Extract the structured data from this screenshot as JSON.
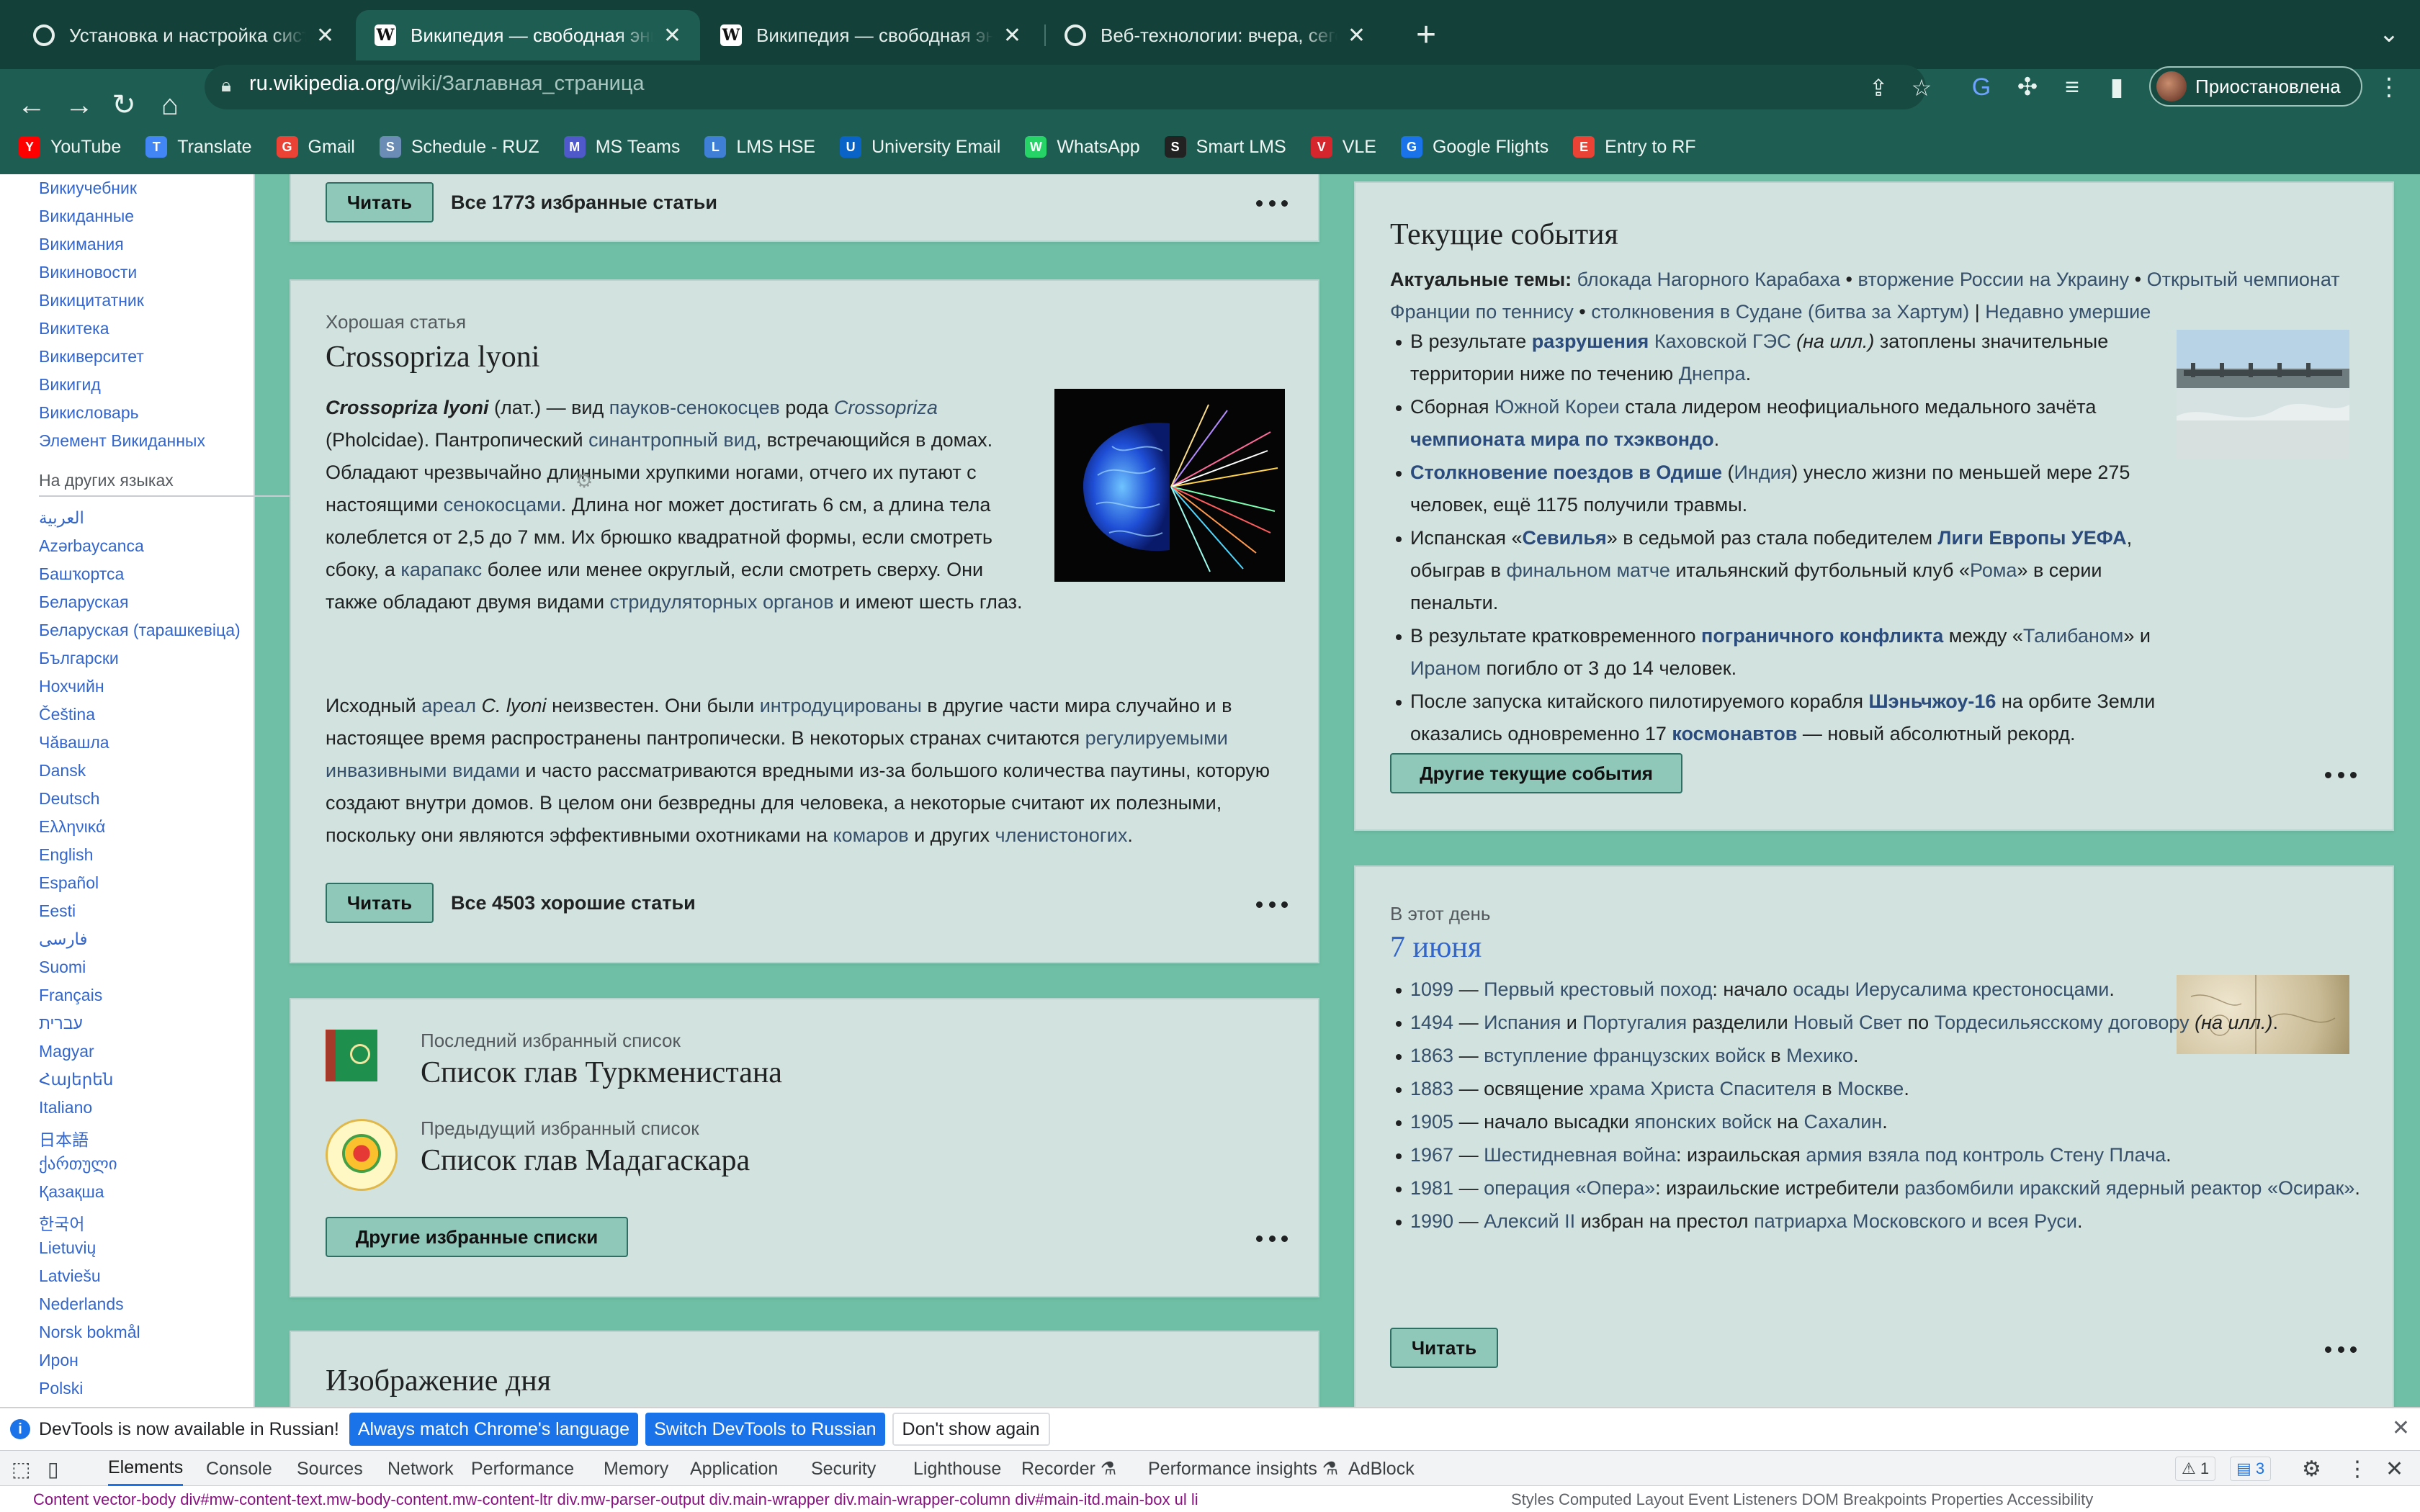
{
  "browser": {
    "tabs": [
      {
        "title": "Установка и настройка систе",
        "icon": "chrome-settings-icon"
      },
      {
        "title": "Википедия — свободная энци",
        "icon": "wikipedia-icon",
        "active": true
      },
      {
        "title": "Википедия — свободная энци",
        "icon": "wikipedia-icon"
      },
      {
        "title": "Веб-технологии: вчера, сегод",
        "icon": "chrome-settings-icon"
      }
    ],
    "url_domain": "ru.wikipedia.org",
    "url_path": "/wiki/Заглавная_страница",
    "profile_status": "Приостановлена",
    "bookmarks": [
      {
        "label": "YouTube",
        "icon": "youtube-icon",
        "color": "#ff0000"
      },
      {
        "label": "Translate",
        "icon": "translate-icon",
        "color": "#4285f4"
      },
      {
        "label": "Gmail",
        "icon": "gmail-icon",
        "color": "#ea4335"
      },
      {
        "label": "Schedule - RUZ",
        "icon": "schedule-icon",
        "color": "#6b8db5"
      },
      {
        "label": "MS Teams",
        "icon": "teams-icon",
        "color": "#5059c9"
      },
      {
        "label": "LMS HSE",
        "icon": "lms-icon",
        "color": "#3f7fd6"
      },
      {
        "label": "University Email",
        "icon": "outlook-icon",
        "color": "#0a64c8"
      },
      {
        "label": "WhatsApp",
        "icon": "whatsapp-icon",
        "color": "#25d366"
      },
      {
        "label": "Smart LMS",
        "icon": "smartlms-icon",
        "color": "#222222"
      },
      {
        "label": "VLE",
        "icon": "vle-icon",
        "color": "#d4262c"
      },
      {
        "label": "Google Flights",
        "icon": "flights-icon",
        "color": "#1a73e8"
      },
      {
        "label": "Entry to RF",
        "icon": "google-icon",
        "color": "#ea4335"
      }
    ]
  },
  "sidebar": {
    "projects": [
      "Викиучебник",
      "Викиданные",
      "Викимания",
      "Викиновости",
      "Викицитатник",
      "Викитека",
      "Викиверситет",
      "Викигид",
      "Викисловарь",
      "Элемент Викиданных"
    ],
    "languages_heading": "На других языках",
    "languages": [
      "العربية",
      "Azərbaycanca",
      "Башҡортса",
      "Беларуская",
      "Беларуская (тарашкевіца)",
      "Български",
      "Нохчийн",
      "Čeština",
      "Чӑвашла",
      "Dansk",
      "Deutsch",
      "Ελληνικά",
      "English",
      "Español",
      "Eesti",
      "فارسی",
      "Suomi",
      "Français",
      "עברית",
      "Magyar",
      "Հայերեն",
      "Italiano",
      "日本語",
      "ქართული",
      "Қазақша",
      "한국어",
      "Lietuvių",
      "Latviešu",
      "Nederlands",
      "Norsk bokmål",
      "Ирон",
      "Polski"
    ]
  },
  "featured": {
    "read_label": "Читать",
    "all_label": "Все 1773 избранные статьи"
  },
  "good_article": {
    "kicker": "Хорошая статья",
    "title": "Crossopriza lyoni",
    "p1": {
      "t1": "Crossopriza lyoni",
      "t2": " (лат.) — вид ",
      "t3": "пауков-сенокосцев",
      "t4": " рода ",
      "t5": "Crossopriza",
      "t6": " (Pholcidae). Пантропический ",
      "t7": "синантропный вид",
      "t8": ", встречающийся в домах. Обладают чрезвычайно длинными хрупкими ногами, отчего их путают с настоящими ",
      "t9": "сенокосцами",
      "t10": ". Длина ног может достигать 6 см, а длина тела колеблется от 2,5 до 7 мм. Их брюшко квадратной формы, если смотреть сбоку, а ",
      "t11": "карапакс",
      "t12": " более или менее округлый, если смотреть сверху. Они также обладают двумя видами ",
      "t13": "стридуляторных органов",
      "t14": " и имеют шесть глаз."
    },
    "p2": {
      "t1": "Исходный ",
      "t2": "ареал",
      "t3": " C. lyoni",
      "t4": " неизвестен. Они были ",
      "t5": "интродуцированы",
      "t6": " в другие части мира случайно и в настоящее время распространены пантропически. В некоторых странах считаются ",
      "t7": "регулируемыми инвазивными видами",
      "t8": " и часто рассматриваются вредными из-за большого количества паутины, которую создают внутри домов. В целом они безвредны для человека, а некоторые считают их полезными, поскольку они являются эффективными охотниками на ",
      "t9": "комаров",
      "t10": " и других ",
      "t11": "членистоногих",
      "t12": "."
    },
    "read_label": "Читать",
    "all_label": "Все 4503 хорошие статьи"
  },
  "lists": {
    "latest_kicker": "Последний избранный список",
    "latest_title": "Список глав Туркменистана",
    "prev_kicker": "Предыдущий избранный список",
    "prev_title": "Список глав Мадагаскара",
    "more_label": "Другие избранные списки"
  },
  "image_of_day": {
    "title": "Изображение дня"
  },
  "current_events": {
    "title": "Текущие события",
    "topics_label": "Актуальные темы:",
    "topics": [
      {
        "t": " блокада Нагорного Карабаха",
        "link": true
      },
      {
        "t": " • ",
        "link": false
      },
      {
        "t": "вторжение России на Украину",
        "link": true
      },
      {
        "t": " • ",
        "link": false
      },
      {
        "t": "Открытый чемпионат Франции по теннису",
        "link": true
      },
      {
        "t": " • ",
        "link": false
      },
      {
        "t": "столкновения в Судане (битва за Хартум)",
        "link": true
      },
      {
        "t": " | ",
        "link": false
      },
      {
        "t": "Недавно умершие",
        "link": true
      }
    ],
    "items": [
      [
        {
          "t": "В результате "
        },
        {
          "t": "разрушения",
          "b": true
        },
        {
          "t": " "
        },
        {
          "t": "Каховской ГЭС",
          "l": true
        },
        {
          "t": " (на илл.)",
          "i": true
        },
        {
          "t": " затоплены значительные территории ниже по течению "
        },
        {
          "t": "Днепра",
          "l": true
        },
        {
          "t": "."
        }
      ],
      [
        {
          "t": "Сборная "
        },
        {
          "t": "Южной Кореи",
          "l": true
        },
        {
          "t": " стала лидером неофициального медального зачёта "
        },
        {
          "t": "чемпионата мира по тхэквондо",
          "b": true
        },
        {
          "t": "."
        }
      ],
      [
        {
          "t": "Столкновение поездов в Одише",
          "b": true
        },
        {
          "t": " ("
        },
        {
          "t": "Индия",
          "l": true
        },
        {
          "t": ") унесло жизни по меньшей мере 275 человек, ещё 1175 получили травмы."
        }
      ],
      [
        {
          "t": "Испанская «"
        },
        {
          "t": "Севилья",
          "b": true
        },
        {
          "t": "» в седьмой раз стала победителем "
        },
        {
          "t": "Лиги Европы УЕФА",
          "b": true
        },
        {
          "t": ", обыграв в "
        },
        {
          "t": "финальном матче",
          "l": true
        },
        {
          "t": " итальянский футбольный клуб «"
        },
        {
          "t": "Рома",
          "l": true
        },
        {
          "t": "» в серии пенальти."
        }
      ],
      [
        {
          "t": "В результате кратковременного "
        },
        {
          "t": "пограничного конфликта",
          "b": true
        },
        {
          "t": " между «"
        },
        {
          "t": "Талибаном",
          "l": true
        },
        {
          "t": "» и "
        },
        {
          "t": "Ираном",
          "l": true
        },
        {
          "t": " погибло от 3 до 14 человек."
        }
      ],
      [
        {
          "t": "После запуска китайского пилотируемого корабля "
        },
        {
          "t": "Шэньчжоу-16",
          "b": true
        },
        {
          "t": " на орбите Земли оказались одновременно 17 "
        },
        {
          "t": "космонавтов",
          "b": true
        },
        {
          "t": " — новый абсолютный рекорд."
        }
      ]
    ],
    "more_label": "Другие текущие события"
  },
  "on_this_day": {
    "kicker": "В этот день",
    "title": "7 июня",
    "items": [
      [
        {
          "t": "1099",
          "l": true
        },
        {
          "t": " — "
        },
        {
          "t": "Первый крестовый поход",
          "l": true
        },
        {
          "t": ": начало "
        },
        {
          "t": "осады Иерусалима",
          "l": true
        },
        {
          "t": " "
        },
        {
          "t": "крестоносцами",
          "l": true
        },
        {
          "t": "."
        }
      ],
      [
        {
          "t": "1494",
          "l": true
        },
        {
          "t": " — "
        },
        {
          "t": "Испания",
          "l": true
        },
        {
          "t": " и "
        },
        {
          "t": "Португалия",
          "l": true
        },
        {
          "t": " разделили "
        },
        {
          "t": "Новый Свет",
          "l": true
        },
        {
          "t": " по "
        },
        {
          "t": "Тордесильясскому договору",
          "l": true
        },
        {
          "t": " (на илл.)",
          "i": true
        },
        {
          "t": "."
        }
      ],
      [
        {
          "t": "1863",
          "l": true
        },
        {
          "t": " — "
        },
        {
          "t": "вступление французских войск",
          "l": true
        },
        {
          "t": " в "
        },
        {
          "t": "Мехико",
          "l": true
        },
        {
          "t": "."
        }
      ],
      [
        {
          "t": "1883",
          "l": true
        },
        {
          "t": " — освящение "
        },
        {
          "t": "храма Христа Спасителя",
          "l": true
        },
        {
          "t": " в "
        },
        {
          "t": "Москве",
          "l": true
        },
        {
          "t": "."
        }
      ],
      [
        {
          "t": "1905",
          "l": true
        },
        {
          "t": " — начало высадки "
        },
        {
          "t": "японских войск",
          "l": true
        },
        {
          "t": " на "
        },
        {
          "t": "Сахалин",
          "l": true
        },
        {
          "t": "."
        }
      ],
      [
        {
          "t": "1967",
          "l": true
        },
        {
          "t": " — "
        },
        {
          "t": "Шестидневная война",
          "l": true
        },
        {
          "t": ": израильская "
        },
        {
          "t": "армия взяла под контроль",
          "l": true
        },
        {
          "t": " "
        },
        {
          "t": "Стену Плача",
          "l": true
        },
        {
          "t": "."
        }
      ],
      [
        {
          "t": "1981",
          "l": true
        },
        {
          "t": " — "
        },
        {
          "t": "операция «Опера»",
          "l": true
        },
        {
          "t": ": израильские истребители "
        },
        {
          "t": "разбомбили",
          "l": true
        },
        {
          "t": " "
        },
        {
          "t": "иракский ядерный реактор «Осирак»",
          "l": true
        },
        {
          "t": "."
        }
      ],
      [
        {
          "t": "1990",
          "l": true
        },
        {
          "t": " — "
        },
        {
          "t": "Алексий II",
          "l": true
        },
        {
          "t": " избран на престол "
        },
        {
          "t": "патриарха Московского и всея Руси",
          "l": true
        },
        {
          "t": "."
        }
      ]
    ],
    "read_label": "Читать"
  },
  "devtools": {
    "info_text": "DevTools is now available in Russian!",
    "btn_match": "Always match Chrome's language",
    "btn_switch": "Switch DevTools to Russian",
    "btn_dismiss": "Don't show again",
    "tabs": [
      "Elements",
      "Console",
      "Sources",
      "Network",
      "Performance",
      "Memory",
      "Application",
      "Security",
      "Lighthouse",
      "Recorder ⚗",
      "Performance insights ⚗",
      "AdBlock"
    ],
    "warnings": "1",
    "messages": "3",
    "breadcrumb": "Content  vector-body  div#mw-content-text.mw-body-content.mw-content-ltr  div.mw-parser-output  div.main-wrapper  div.main-wrapper-column  div#main-itd.main-box  ul  li",
    "side_tabs": "Styles  Computed  Layout  Event Listeners  DOM Breakpoints  Properties  Accessibility"
  }
}
